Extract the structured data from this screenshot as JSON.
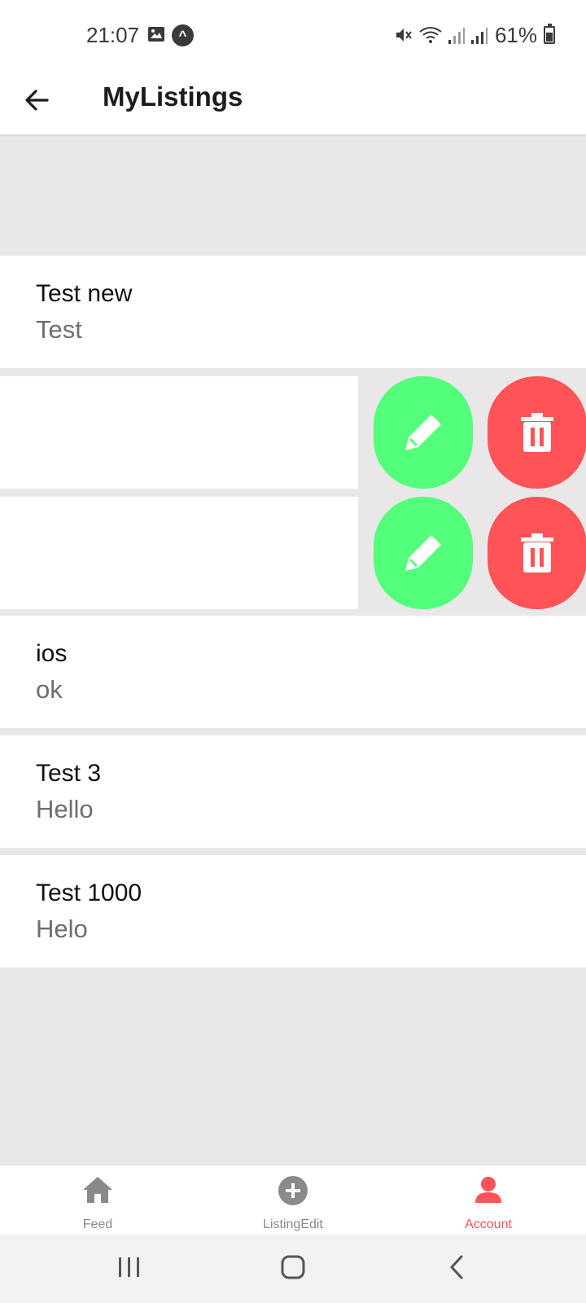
{
  "status_bar": {
    "time": "21:07",
    "battery": "61%"
  },
  "header": {
    "title": "MyListings",
    "back_icon": "arrow-left-icon"
  },
  "listings": [
    {
      "title": "Test new",
      "subtitle": "Test"
    },
    {
      "title": "ios",
      "subtitle": "ok"
    },
    {
      "title": "Test 3",
      "subtitle": "Hello"
    },
    {
      "title": "Test 1000",
      "subtitle": "Helo"
    }
  ],
  "swiped_rows": [
    {
      "edit_icon": "pencil-icon",
      "delete_icon": "trash-icon"
    },
    {
      "edit_icon": "pencil-icon",
      "delete_icon": "trash-icon"
    }
  ],
  "tabs": [
    {
      "label": "Feed",
      "icon": "home-icon",
      "active": false
    },
    {
      "label": "ListingEdit",
      "icon": "plus-circle-icon",
      "active": false
    },
    {
      "label": "Account",
      "icon": "account-icon",
      "active": true
    }
  ],
  "colors": {
    "edit": "#53fe7b",
    "delete": "#fe5357",
    "accent": "#fe5357",
    "background": "#e9e7e8"
  }
}
